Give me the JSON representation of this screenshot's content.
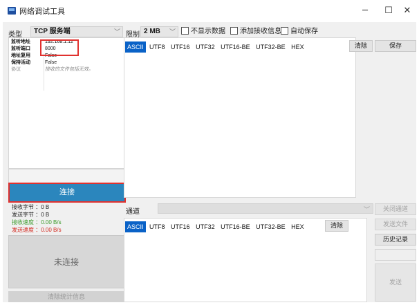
{
  "window": {
    "title": "网络调试工具",
    "minimize": "─",
    "maximize": "☐",
    "close": "✕"
  },
  "toolbar": {
    "type_label": "类型",
    "type_value": "TCP 服务端",
    "limit_label": "限制",
    "limit_value": "2 MB",
    "no_display_label": "不显示数据",
    "add_recv_info_label": "添加接收信息",
    "auto_save_label": "自动保存"
  },
  "properties": [
    {
      "key": "监听地址",
      "value": "192.168.1.12"
    },
    {
      "key": "监听端口",
      "value": "8000"
    },
    {
      "key": "地址复用",
      "value": "False"
    },
    {
      "key": "保持活动",
      "value": "False"
    },
    {
      "key": "协议",
      "value": "接收的文件包括无效。"
    }
  ],
  "connect_button": "连接",
  "stats": {
    "recv_bytes": "接收字节 ：0 B",
    "send_bytes": "发送字节 ：0 B",
    "recv_speed": "接收速度 ：0.00 B/s",
    "send_speed": "发送速度 ：0.00 B/s"
  },
  "status": {
    "connection": "未连接",
    "clear_stats": "清除统计信息"
  },
  "encodings": [
    "ASCII",
    "UTF8",
    "UTF16",
    "UTF32",
    "UTF16-BE",
    "UTF32-BE",
    "HEX"
  ],
  "receive": {
    "clear_button": "清除",
    "save_button": "保存"
  },
  "send": {
    "channel_label": "通道",
    "clear_button": "清除",
    "close_channel_button": "关闭通道",
    "send_file_button": "发送文件",
    "history_button": "历史记录",
    "send_button": "发送"
  },
  "colors": {
    "accent": "#2b86bd",
    "selected_encoding": "#0a62c7",
    "highlight_box": "#e0312e",
    "recv_speed_text": "#3a9a2a",
    "send_speed_text": "#d2281e"
  }
}
